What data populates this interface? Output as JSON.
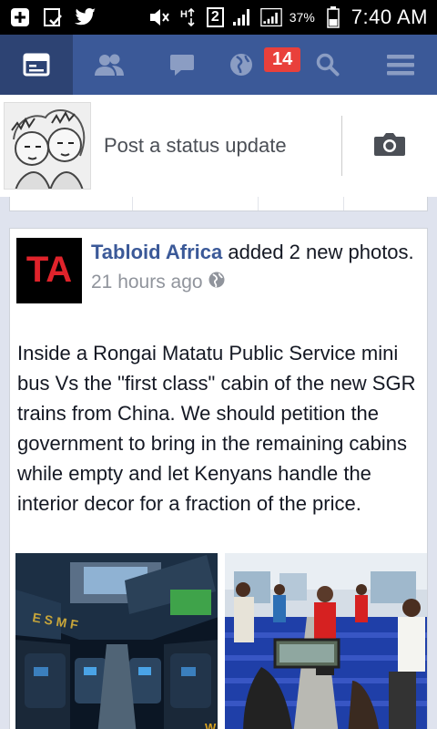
{
  "status_bar": {
    "signal_number": "2",
    "battery_percent": "37%",
    "time": "7:40 AM"
  },
  "navbar": {
    "notifications_badge": "14",
    "colors": {
      "background": "#3b5998",
      "active": "#2d4373",
      "badge": "#e9403b"
    }
  },
  "composer": {
    "prompt": "Post a status update"
  },
  "post": {
    "page_name": "Tabloid Africa",
    "action": "added 2 new photos.",
    "timestamp": "21 hours ago",
    "logo_text": "TA",
    "body": "Inside a Rongai Matatu Public Service mini bus Vs the \"first class\" cabin of the new SGR trains from China. We should petition the government to bring in the remaining cabins while empty and let Kenyans handle the interior decor for a fraction of the price."
  },
  "icons": [
    "news-feed-icon",
    "friends-icon",
    "messages-icon",
    "globe-icon",
    "search-icon",
    "menu-icon",
    "camera-icon"
  ]
}
